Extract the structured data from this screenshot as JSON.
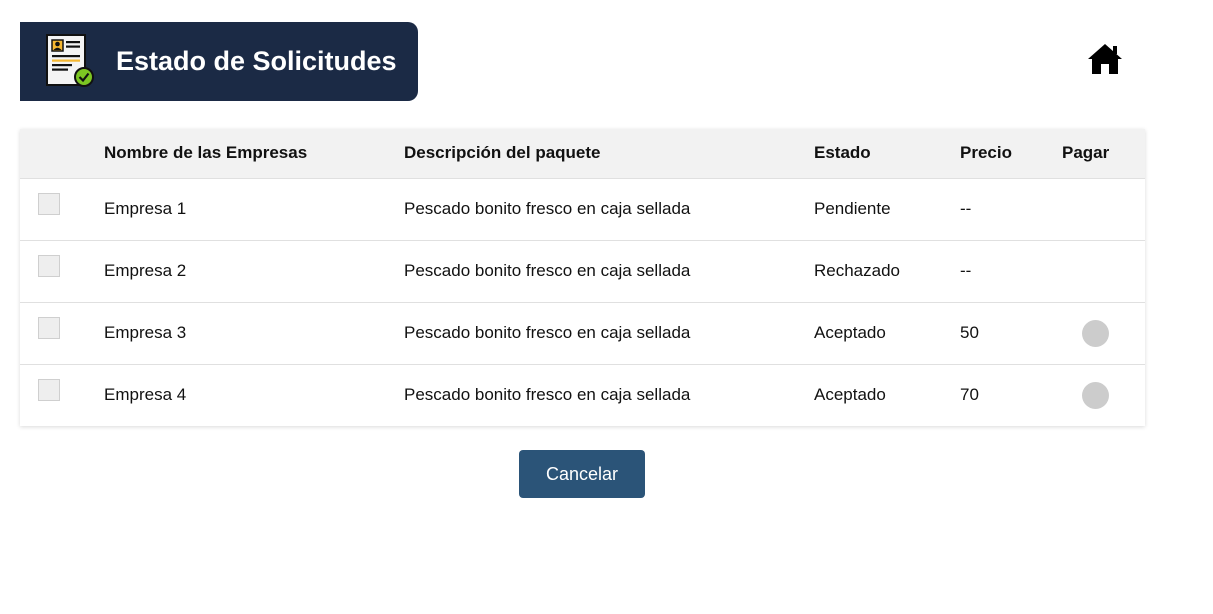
{
  "header": {
    "title": "Estado de Solicitudes",
    "icon": "document-check-icon"
  },
  "nav": {
    "home_icon": "home-icon"
  },
  "table": {
    "columns": [
      "",
      "Nombre de las Empresas",
      "Descripción del paquete",
      "Estado",
      "Precio",
      "Pagar"
    ],
    "rows": [
      {
        "company": "Empresa 1",
        "description": "Pescado bonito fresco en caja sellada",
        "status": "Pendiente",
        "price": "--",
        "pay": false
      },
      {
        "company": "Empresa 2",
        "description": "Pescado bonito fresco en caja sellada",
        "status": "Rechazado",
        "price": "--",
        "pay": false
      },
      {
        "company": "Empresa 3",
        "description": "Pescado bonito fresco en caja sellada",
        "status": "Aceptado",
        "price": "50",
        "pay": true
      },
      {
        "company": "Empresa 4",
        "description": "Pescado bonito fresco en caja sellada",
        "status": "Aceptado",
        "price": "70",
        "pay": true
      }
    ]
  },
  "actions": {
    "cancel_label": "Cancelar"
  },
  "colors": {
    "header_bg": "#1b2a45",
    "button_bg": "#2b5478",
    "table_header_bg": "#f2f2f2",
    "pay_radio": "#cccccc"
  }
}
